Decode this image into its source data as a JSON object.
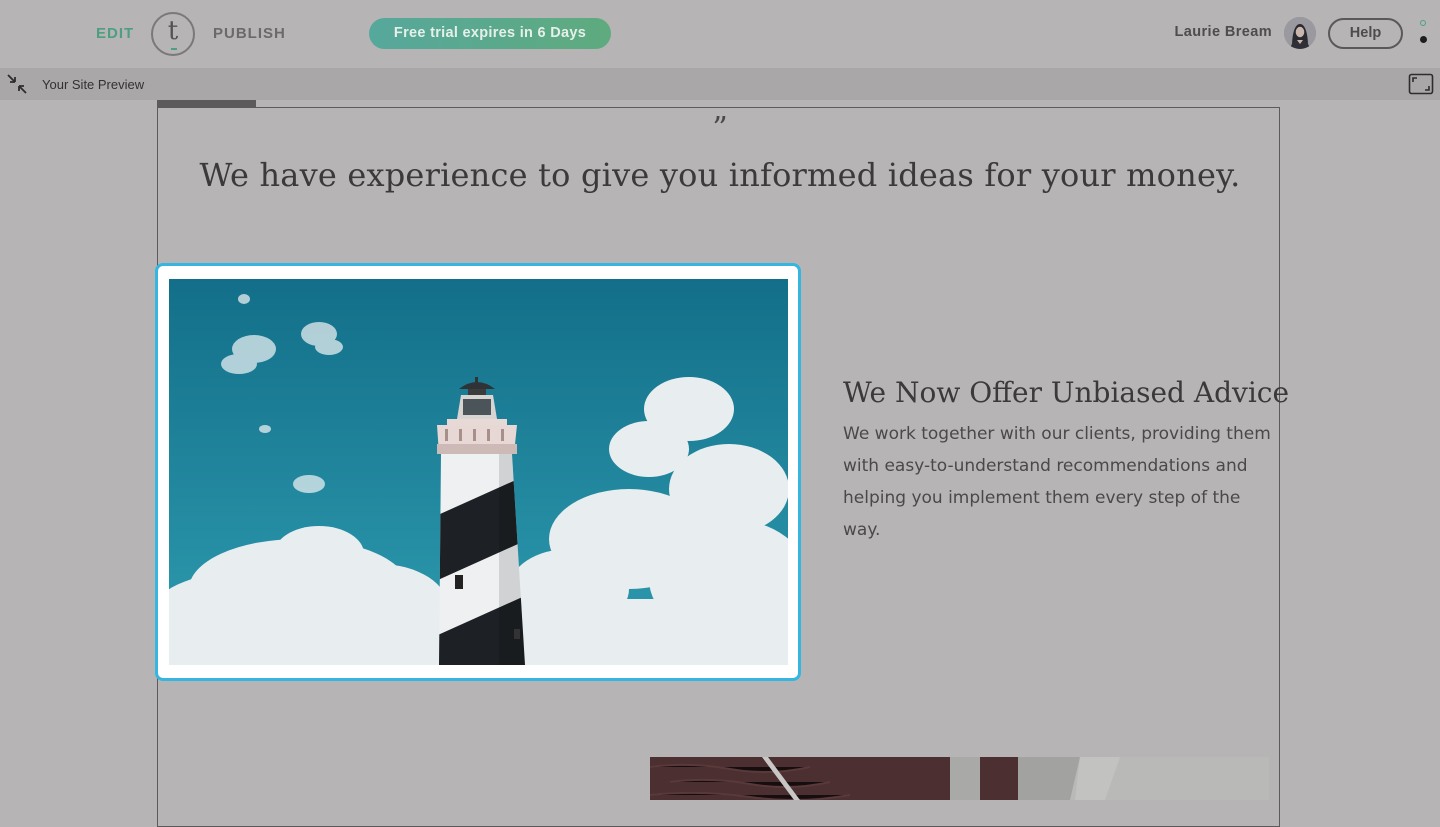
{
  "header": {
    "edit_label": "EDIT",
    "logo_letter": "t",
    "publish_label": "PUBLISH",
    "trial_text": "Free trial expires in 6 Days",
    "user_name": "Laurie Bream",
    "help_label": "Help"
  },
  "preview_bar": {
    "label": "Your Site Preview"
  },
  "site": {
    "quote_mark": "”",
    "quote_text": "We have experience to give you informed ideas for your money.",
    "feature_heading": "We Now Offer Unbiased Advice",
    "feature_body": "We work together with our clients, providing them with easy-to-understand recommendations and helping you implement them every step of the way."
  },
  "icons": {
    "collapse": "collapse-arrows-icon",
    "expand": "expand-corners-icon",
    "more": "kebab-menu-icon"
  },
  "colors": {
    "accent_green": "#4f9e82",
    "selection_blue": "#35b6e1",
    "overlay_gray": "#b6b4b5"
  }
}
